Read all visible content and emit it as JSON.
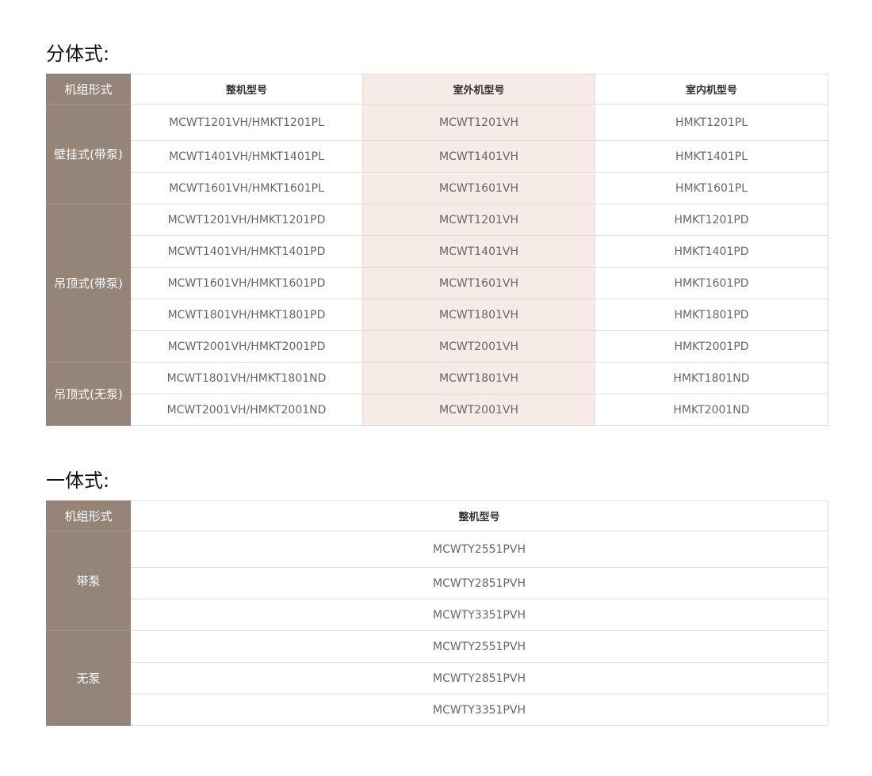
{
  "split": {
    "title": "分体式:",
    "headers": [
      "机组形式",
      "整机型号",
      "室外机型号",
      "室内机型号"
    ],
    "groups": [
      {
        "name": "壁挂式(带泵)",
        "rows": [
          [
            "MCWT1201VH/HMKT1201PL",
            "MCWT1201VH",
            "HMKT1201PL"
          ],
          [
            "MCWT1401VH/HMKT1401PL",
            "MCWT1401VH",
            "HMKT1401PL"
          ],
          [
            "MCWT1601VH/HMKT1601PL",
            "MCWT1601VH",
            "HMKT1601PL"
          ]
        ]
      },
      {
        "name": "吊顶式(带泵)",
        "rows": [
          [
            "MCWT1201VH/HMKT1201PD",
            "MCWT1201VH",
            "HMKT1201PD"
          ],
          [
            "MCWT1401VH/HMKT1401PD",
            "MCWT1401VH",
            "HMKT1401PD"
          ],
          [
            "MCWT1601VH/HMKT1601PD",
            "MCWT1601VH",
            "HMKT1601PD"
          ],
          [
            "MCWT1801VH/HMKT1801PD",
            "MCWT1801VH",
            "HMKT1801PD"
          ],
          [
            "MCWT2001VH/HMKT2001PD",
            "MCWT2001VH",
            "HMKT2001PD"
          ]
        ]
      },
      {
        "name": "吊顶式(无泵)",
        "rows": [
          [
            "MCWT1801VH/HMKT1801ND",
            "MCWT1801VH",
            "HMKT1801ND"
          ],
          [
            "MCWT2001VH/HMKT2001ND",
            "MCWT2001VH",
            "HMKT2001ND"
          ]
        ]
      }
    ]
  },
  "integrated": {
    "title": "一体式:",
    "headers": [
      "机组形式",
      "整机型号"
    ],
    "groups": [
      {
        "name": "带泵",
        "rows": [
          [
            "MCWTY2551PVH"
          ],
          [
            "MCWTY2851PVH"
          ],
          [
            "MCWTY3351PVH"
          ]
        ]
      },
      {
        "name": "无泵",
        "rows": [
          [
            "MCWTY2551PVH"
          ],
          [
            "MCWTY2851PVH"
          ],
          [
            "MCWTY3351PVH"
          ]
        ]
      }
    ]
  },
  "colors": {
    "group_cell_bg": "#958579",
    "outdoor_column_bg": "#f6ebe6",
    "border": "#dedede"
  }
}
